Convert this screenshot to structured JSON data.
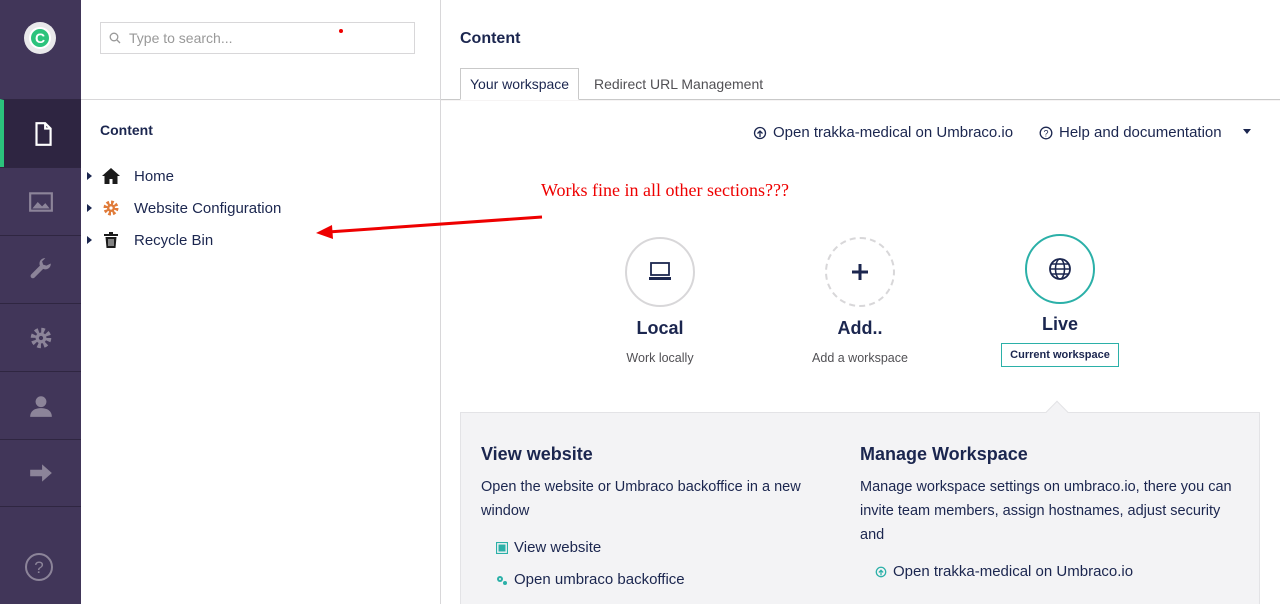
{
  "search": {
    "placeholder": "Type to search..."
  },
  "tree": {
    "title": "Content",
    "nodes": [
      {
        "label": "Home",
        "icon": "home-icon"
      },
      {
        "label": "Website Configuration",
        "icon": "cog-icon"
      },
      {
        "label": "Recycle Bin",
        "icon": "trash-icon"
      }
    ]
  },
  "main": {
    "title": "Content",
    "tabs": [
      "Your workspace",
      "Redirect URL Management"
    ],
    "open_link": "Open trakka-medical on Umbraco.io",
    "help_link": "Help and documentation"
  },
  "annotation": "Works fine in all other sections???",
  "workspaces": [
    {
      "name": "Local",
      "sub": "Work locally",
      "icon": "laptop-icon"
    },
    {
      "name": "Add..",
      "sub": "Add a workspace",
      "icon": "plus-icon"
    },
    {
      "name": "Live",
      "badge": "Current workspace",
      "icon": "globe-icon"
    }
  ],
  "panel": {
    "view": {
      "title": "View website",
      "text": "Open the website or Umbraco backoffice in a new window",
      "links": [
        "View website",
        "Open umbraco backoffice"
      ]
    },
    "manage": {
      "title": "Manage Workspace",
      "text": "Manage workspace settings on umbraco.io, there you can invite team members, assign hostnames, adjust security and",
      "link": "Open trakka-medical on Umbraco.io"
    }
  },
  "colors": {
    "rail": "#413659",
    "accent": "#2bc37c",
    "teal": "#2bb0a8",
    "annotation": "#e00000"
  }
}
